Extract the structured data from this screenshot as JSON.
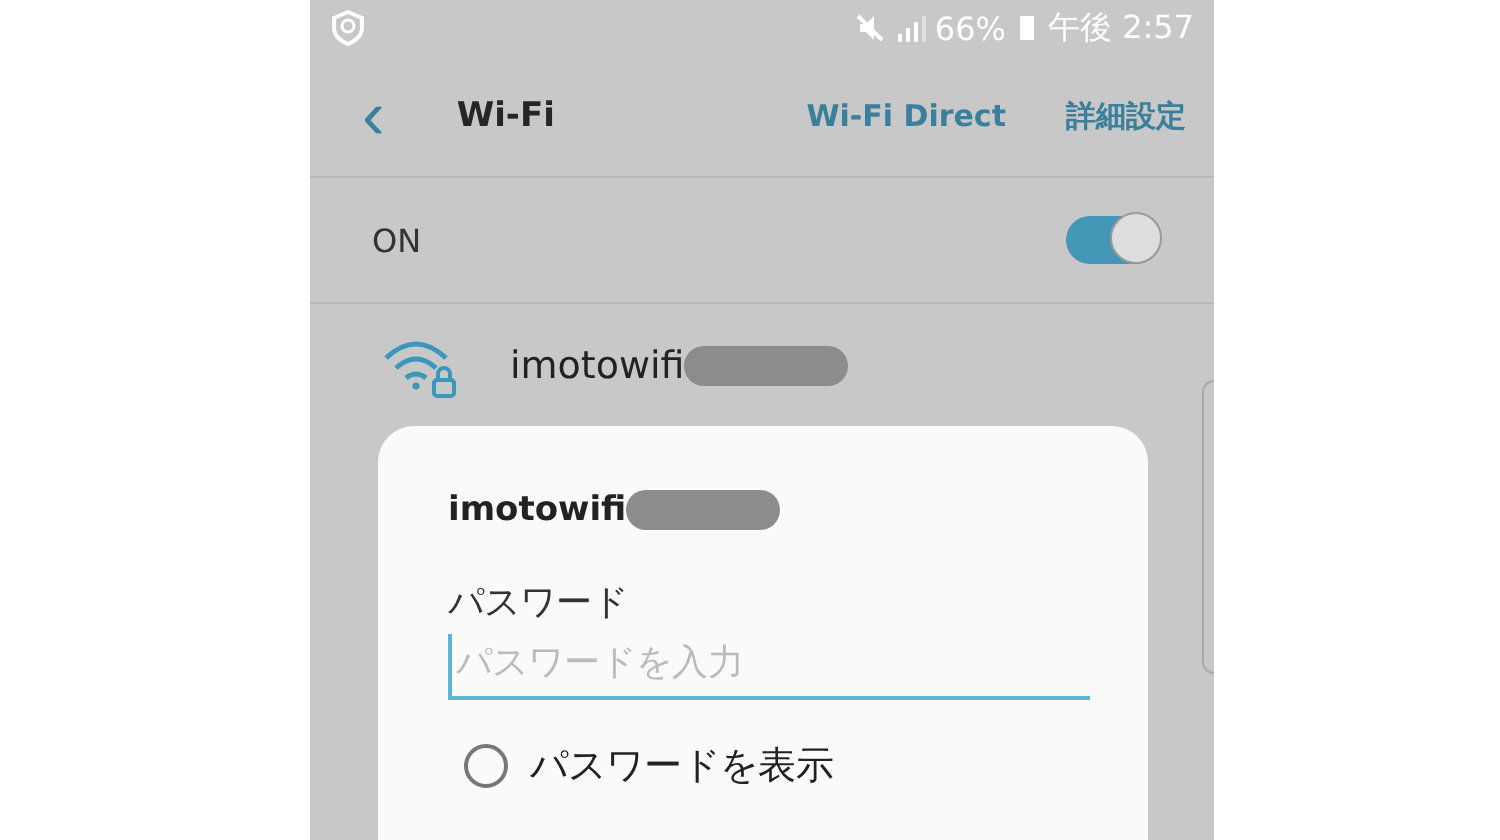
{
  "status_bar": {
    "battery": "66%",
    "time": "午後 2:57"
  },
  "header": {
    "back": "‹",
    "title": "Wi-Fi",
    "actions": [
      "Wi-Fi Direct",
      "詳細設定"
    ]
  },
  "wifi_switch": {
    "label": "ON",
    "on": true
  },
  "networks": [
    {
      "name": "imotowifi",
      "locked": true
    }
  ],
  "dialog": {
    "title": "imotowifi",
    "password_label": "パスワード",
    "password_field": {
      "placeholder": "パスワードを入力"
    },
    "show_password": {
      "label": "パスワードを表示",
      "checked": false
    }
  }
}
